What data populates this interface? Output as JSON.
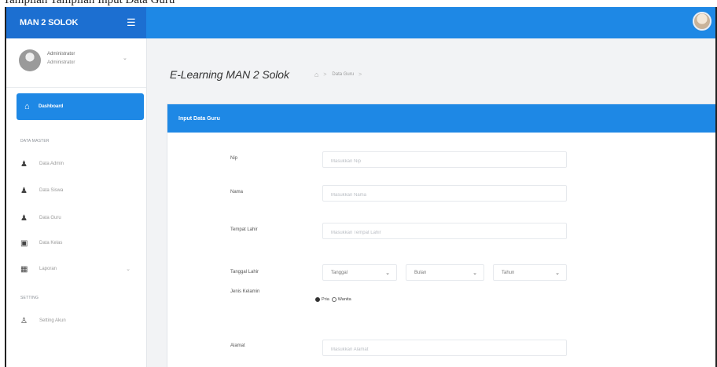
{
  "caption": "Tampilan Tampilan Input Data Guru",
  "topbar": {
    "brand": "MAN 2 SOLOK",
    "menu_icon": "hamburger-icon"
  },
  "sidebar": {
    "user": {
      "name": "Administrator",
      "role": "Administrator"
    },
    "dashboard_label": "Dashboard",
    "section_master": "DATA MASTER",
    "items": [
      {
        "label": "Data Admin",
        "icon": "user-plus-icon"
      },
      {
        "label": "Data Siswa",
        "icon": "user-plus-icon"
      },
      {
        "label": "Data Guru",
        "icon": "user-plus-icon"
      },
      {
        "label": "Data Kelas",
        "icon": "edit-icon"
      },
      {
        "label": "Laporan",
        "icon": "table-icon"
      }
    ],
    "section_setting": "SETTING",
    "setting_item": {
      "label": "Setting Akun",
      "icon": "user-icon"
    }
  },
  "header": {
    "title": "E-Learning MAN 2 Solok",
    "breadcrumb": "Data Guru"
  },
  "form": {
    "title": "Input Data Guru",
    "nip_label": "Nip",
    "nip_placeholder": "Masukkan Nip",
    "nama_label": "Nama",
    "nama_placeholder": "Masukkan Nama",
    "tempat_label": "Tempat Lahir",
    "tempat_placeholder": "Masukkan Tempat Lahir",
    "tanggal_label": "Tanggal Lahir",
    "tanggal_select": "Tanggal",
    "bulan_select": "Bulan",
    "tahun_select": "Tahun",
    "jk_label": "Jenis Kelamin",
    "jk_option_pria": "Pria",
    "jk_option_wanita": "Wanita",
    "jk_selected": "Pria",
    "alamat_label": "Alamat",
    "alamat_placeholder": "Masukkan Alamat"
  },
  "colors": {
    "primary": "#1e88e5",
    "brand_dark": "#1c6fd1"
  }
}
